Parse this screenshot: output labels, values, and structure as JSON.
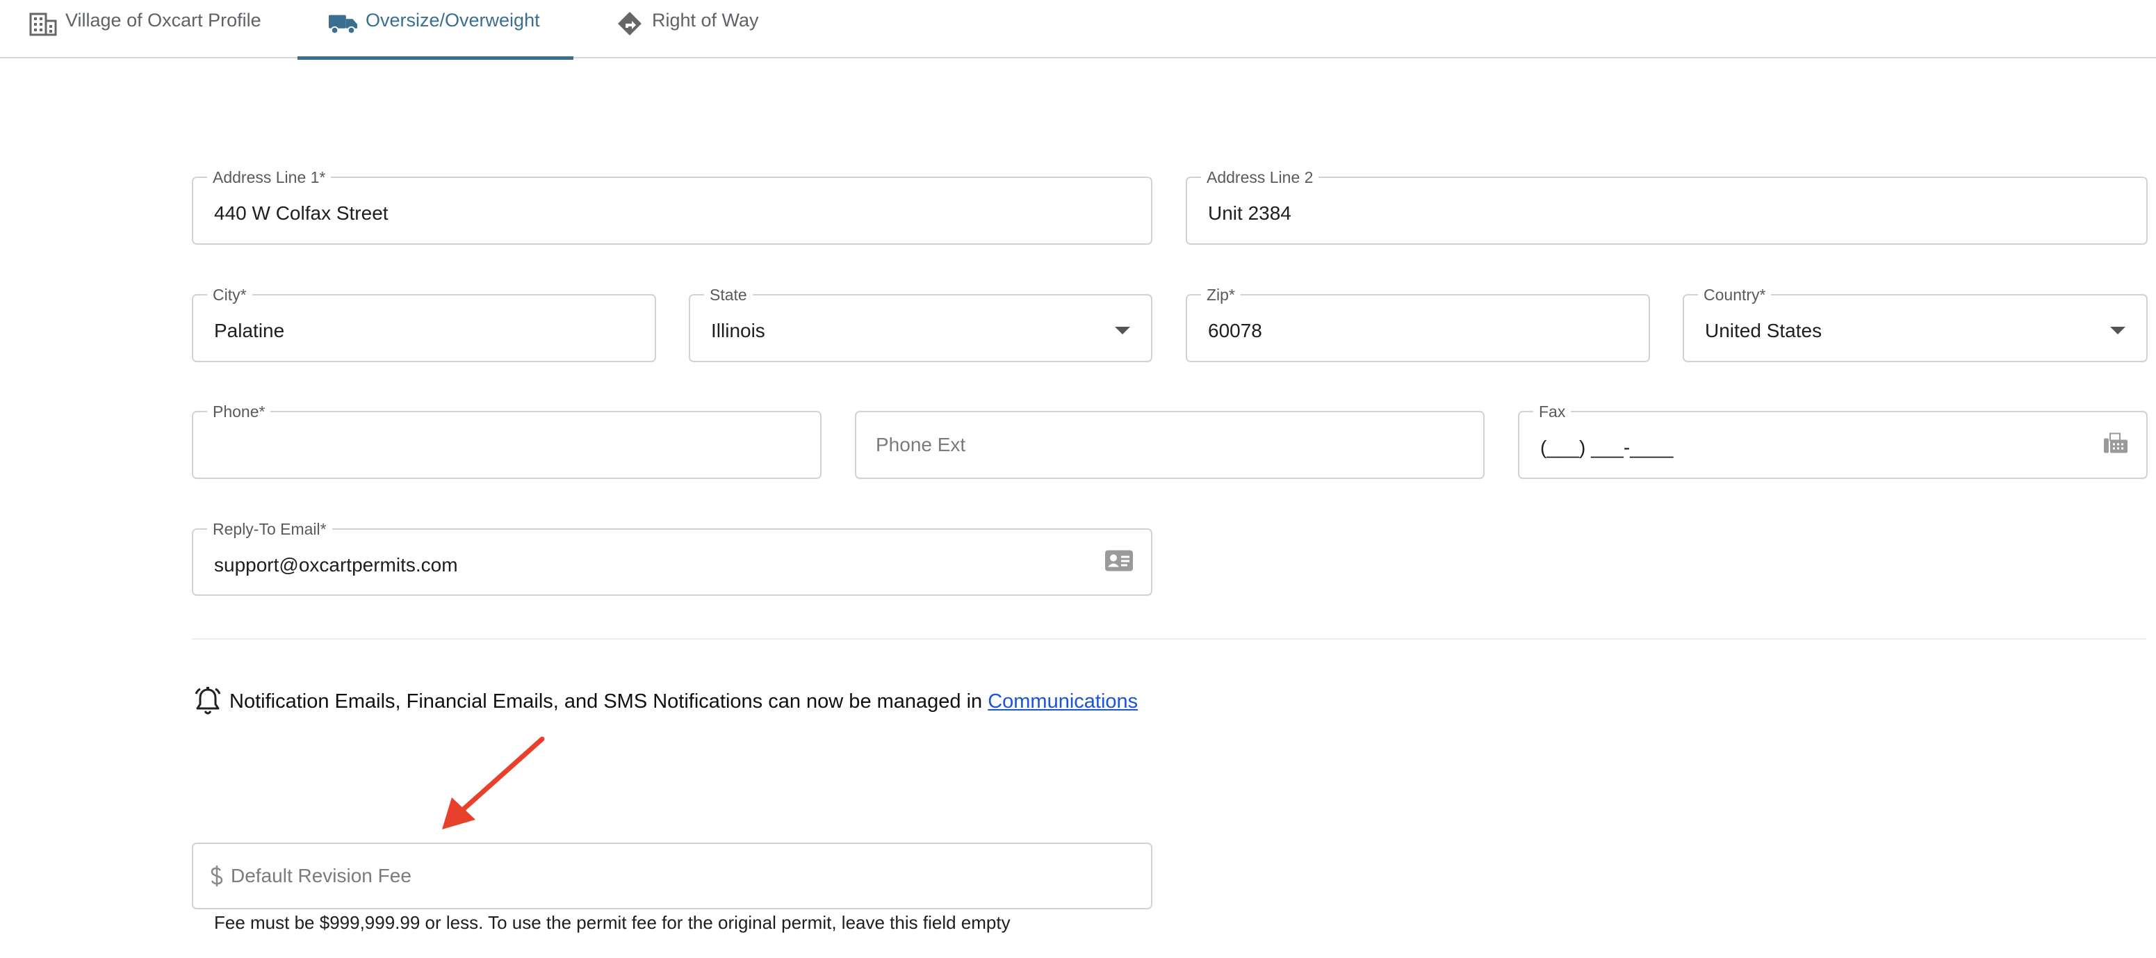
{
  "tabs": [
    {
      "label": "Village of Oxcart Profile",
      "icon": "building-icon",
      "active": false
    },
    {
      "label": "Oversize/Overweight",
      "icon": "truck-icon",
      "active": true
    },
    {
      "label": "Right of Way",
      "icon": "road-sign-icon",
      "active": false
    }
  ],
  "form": {
    "address1": {
      "label": "Address Line 1*",
      "value": "440 W Colfax Street"
    },
    "address2": {
      "label": "Address Line 2",
      "value": "Unit 2384"
    },
    "city": {
      "label": "City*",
      "value": "Palatine"
    },
    "state": {
      "label": "State",
      "value": "Illinois"
    },
    "zip": {
      "label": "Zip*",
      "value": "60078"
    },
    "country": {
      "label": "Country*",
      "value": "United States"
    },
    "phone": {
      "label": "Phone*",
      "value": ""
    },
    "phone_ext": {
      "placeholder": "Phone Ext"
    },
    "fax": {
      "label": "Fax",
      "value": "(___) ___-____",
      "icon": "fax-icon"
    },
    "reply_email": {
      "label": "Reply-To Email*",
      "value": "support@oxcartpermits.com",
      "icon": "contact-card-icon"
    }
  },
  "notice": {
    "text": "Notification Emails, Financial Emails, and SMS Notifications can now be managed in",
    "link": "Communications",
    "icon": "bell-icon"
  },
  "revision_fee": {
    "placeholder": "Default Revision Fee",
    "icon": "dollar-icon",
    "help": "Fee must be $999,999.99 or less. To use the permit fee for the original permit, leave this field empty"
  },
  "colors": {
    "accent": "#3a6f92",
    "link": "#1a55d8",
    "annotation_arrow": "#e8402a"
  }
}
